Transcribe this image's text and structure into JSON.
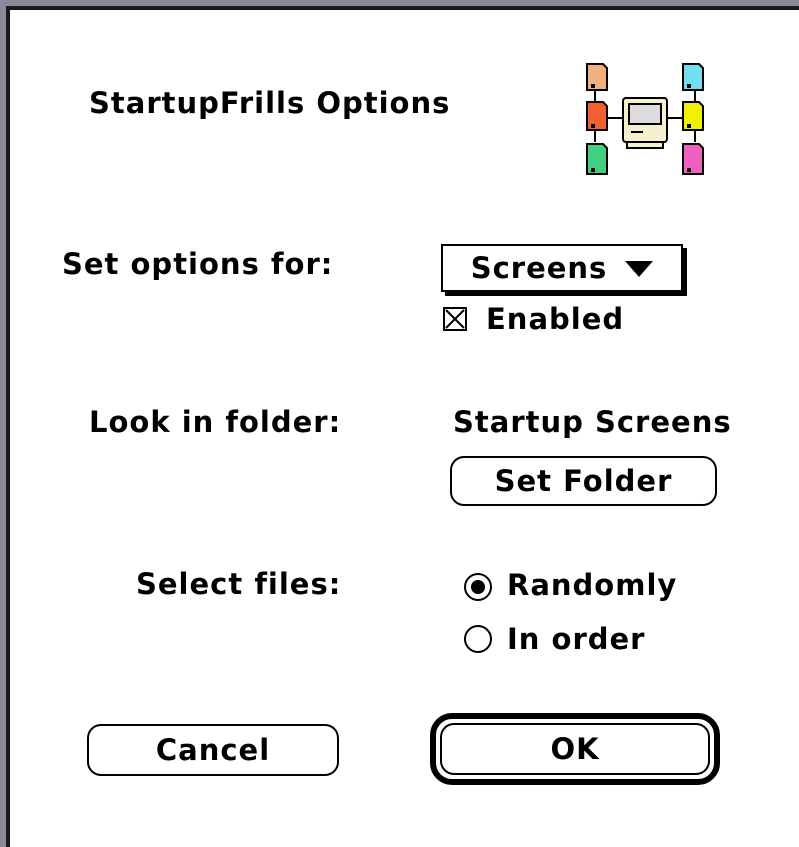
{
  "dialog": {
    "title": "StartupFrills Options",
    "app_icon": "startupfrills-app-icon",
    "options_for": {
      "label": "Set options for:",
      "selected": "Screens",
      "enabled_label": "Enabled",
      "enabled_checked": true
    },
    "folder": {
      "label": "Look in folder:",
      "value": "Startup Screens",
      "set_button": "Set Folder"
    },
    "select_files": {
      "label": "Select files:",
      "options": [
        {
          "label": "Randomly",
          "selected": true
        },
        {
          "label": "In order",
          "selected": false
        }
      ]
    },
    "buttons": {
      "cancel": "Cancel",
      "ok": "OK"
    }
  },
  "colors": {
    "icon_peach": "#f0b080",
    "icon_orange": "#f06030",
    "icon_green": "#40d080",
    "icon_cyan": "#70e0f0",
    "icon_yellow": "#f0f000",
    "icon_pink": "#f060c0"
  }
}
